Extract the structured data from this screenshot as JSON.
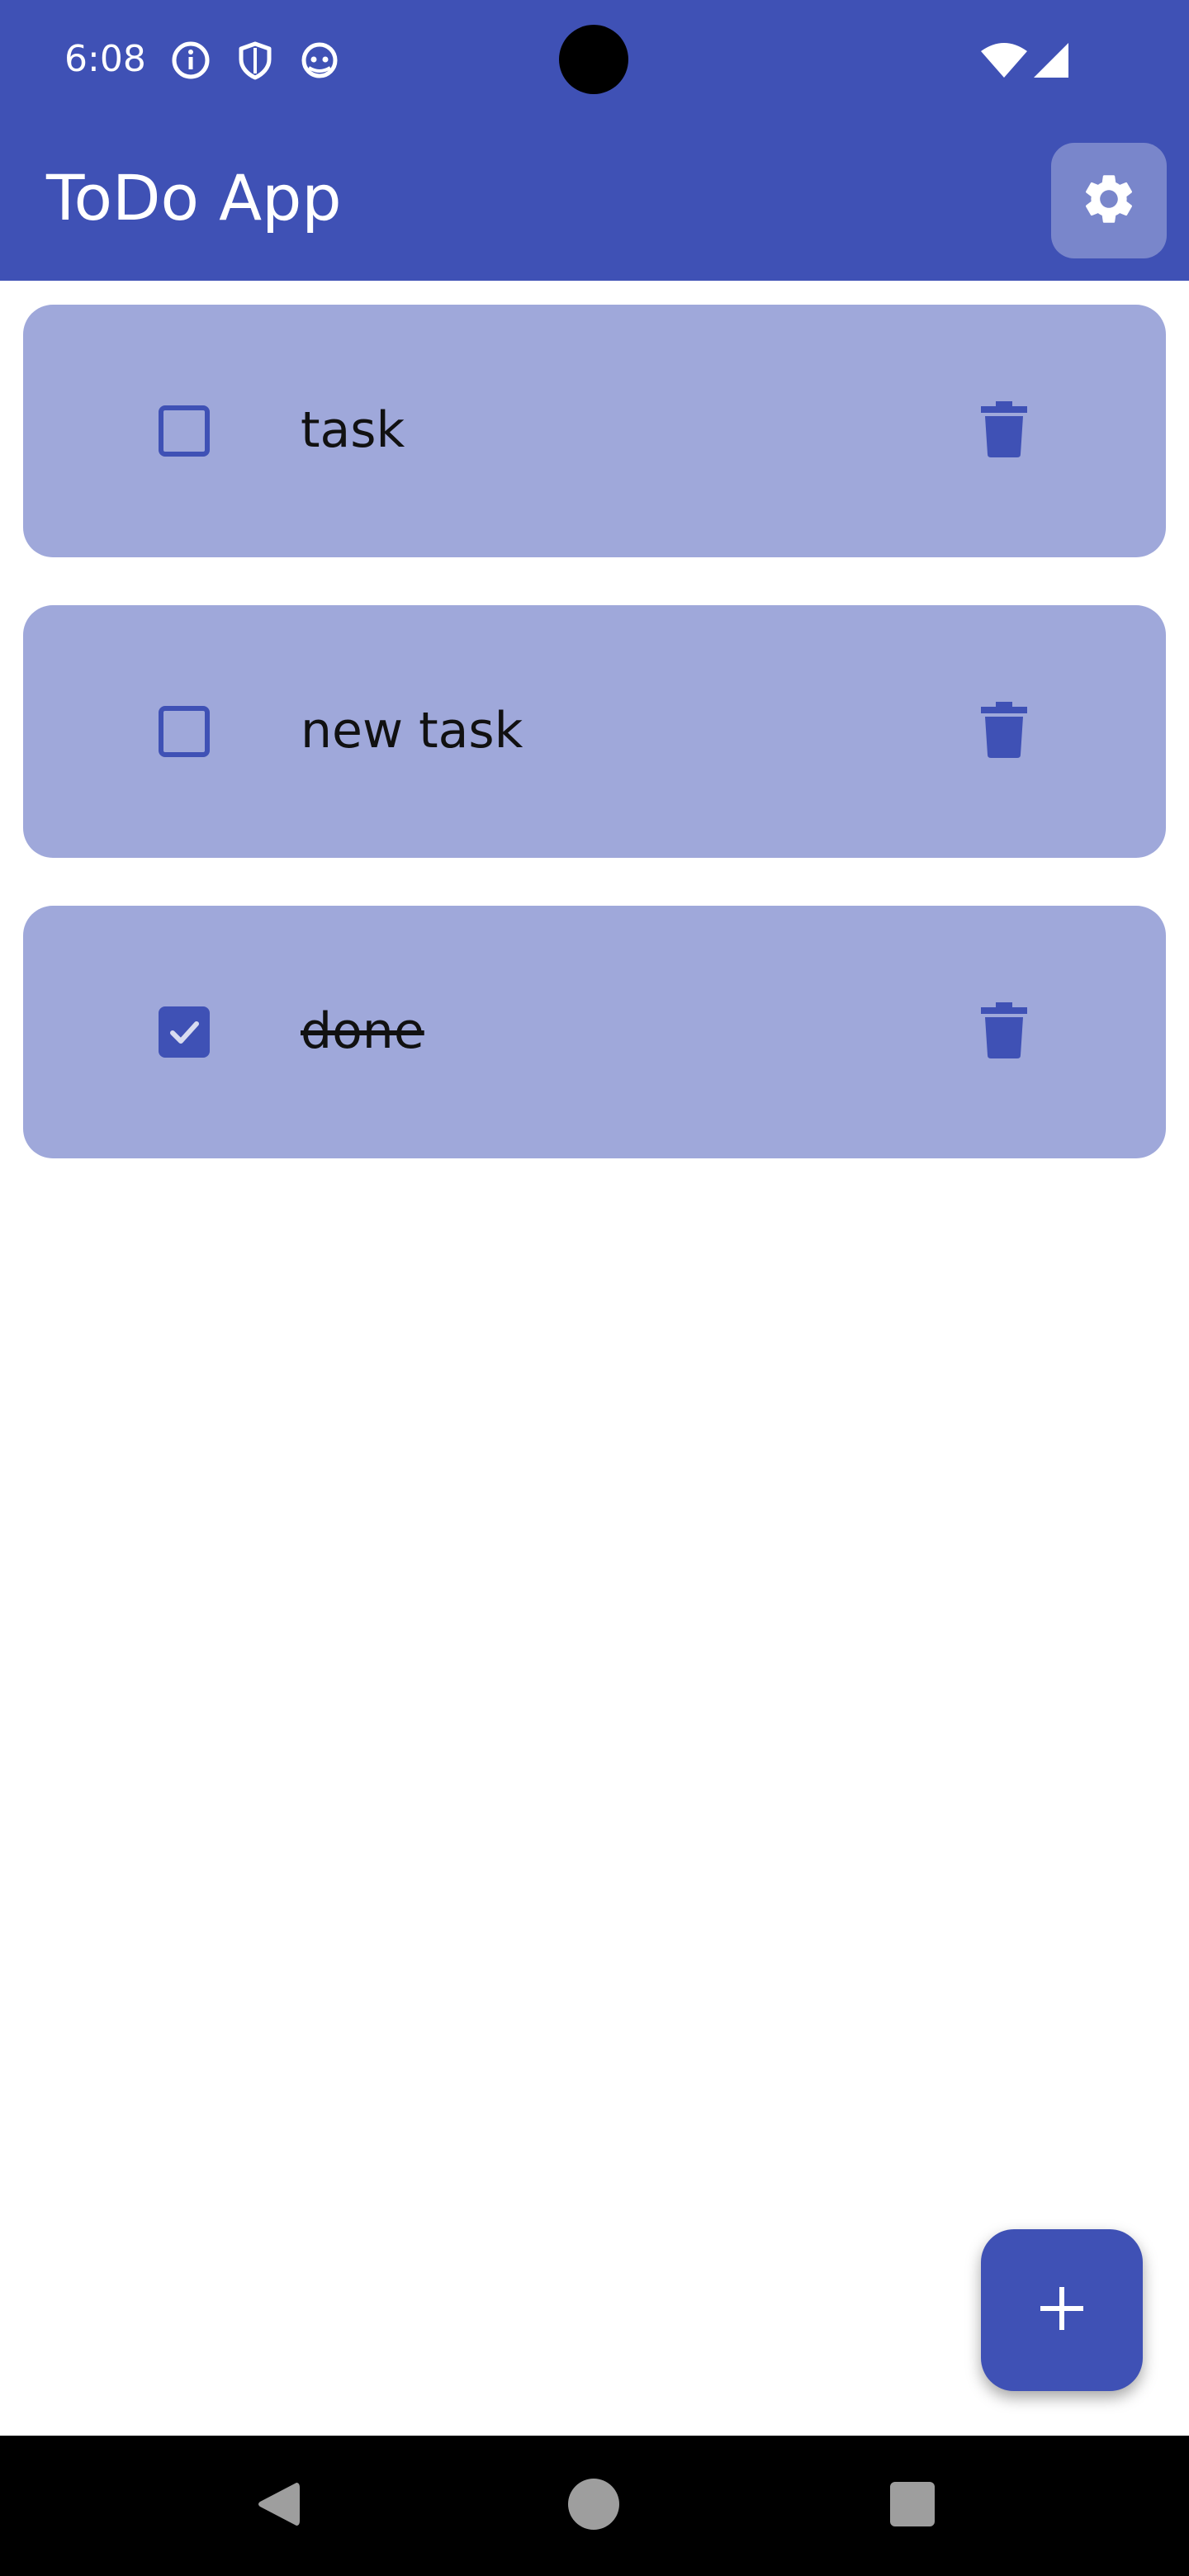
{
  "status_bar": {
    "time": "6:08",
    "icons": [
      "info-icon",
      "shield-icon",
      "android-icon",
      "wifi-icon",
      "signal-icon"
    ]
  },
  "app_bar": {
    "title": "ToDo App",
    "settings_icon": "gear-icon"
  },
  "tasks": [
    {
      "label": "task",
      "checked": false
    },
    {
      "label": "new task",
      "checked": false
    },
    {
      "label": "done",
      "checked": true
    }
  ],
  "fab": {
    "icon": "plus-icon"
  },
  "nav_bar": {
    "icons": [
      "back-icon",
      "home-icon",
      "recents-icon"
    ]
  },
  "colors": {
    "primary": "#3f51b5",
    "card": "#9fa8da",
    "settings_button": "#7986cb"
  }
}
